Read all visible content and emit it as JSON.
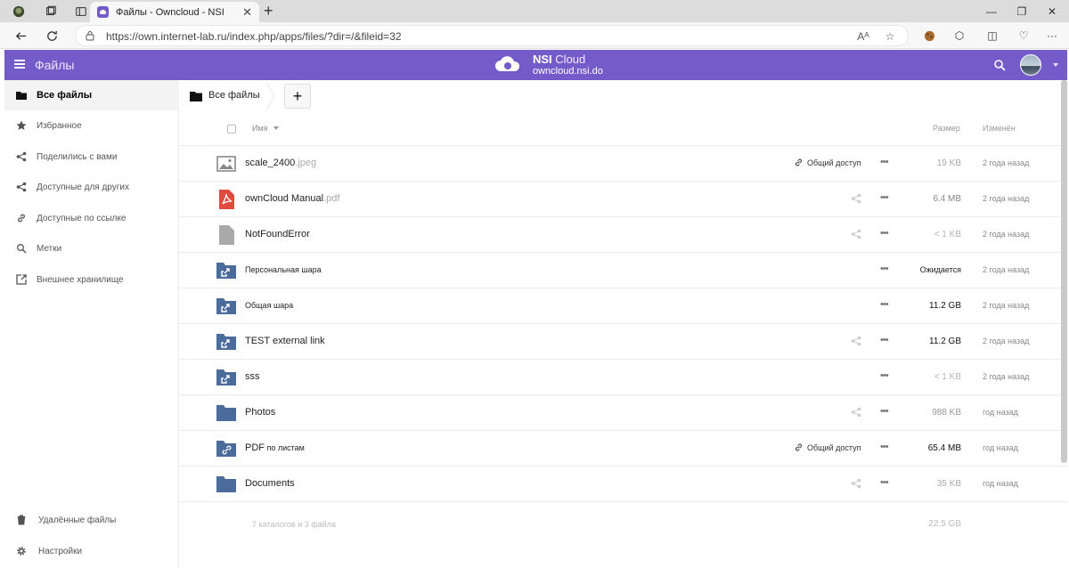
{
  "browser": {
    "tab_title": "Файлы - Owncloud - NSI",
    "url": "https://own.internet-lab.ru/index.php/apps/files/?dir=/&fileid=32"
  },
  "header": {
    "app_title": "Файлы",
    "brand_name": "NSI",
    "brand_suffix": "Cloud",
    "brand_domain": "owncloud.nsi.do",
    "accent_color": "#745bca"
  },
  "sidebar": {
    "items": [
      {
        "label": "Все файлы",
        "icon": "folder-icon",
        "active": true
      },
      {
        "label": "Избранное",
        "icon": "star-icon"
      },
      {
        "label": "Поделились с вами",
        "icon": "share-icon"
      },
      {
        "label": "Доступные для других",
        "icon": "share-icon"
      },
      {
        "label": "Доступные по ссылке",
        "icon": "link-icon"
      },
      {
        "label": "Метки",
        "icon": "search-icon"
      },
      {
        "label": "Внешнее хранилище",
        "icon": "external-icon"
      }
    ],
    "bottom": [
      {
        "label": "Удалённые файлы",
        "icon": "trash-icon"
      },
      {
        "label": "Настройки",
        "icon": "gear-icon"
      }
    ]
  },
  "breadcrumb": {
    "label": "Все файлы"
  },
  "new_button": "+",
  "table": {
    "headers": {
      "name": "Имя",
      "size": "Размер",
      "modified": "Изменён"
    },
    "rows": [
      {
        "name": "scale_2400",
        "ext": ".jpeg",
        "icon": "image-icon",
        "shared_label": "Общий доступ",
        "size": "19 KB",
        "modified": "2 года назад"
      },
      {
        "name": "ownCloud Manual",
        "ext": ".pdf",
        "icon": "pdf-icon",
        "shared_label": "",
        "size": "6.4 MB",
        "modified": "2 года назад"
      },
      {
        "name": "NotFoundError",
        "ext": "",
        "icon": "file-icon",
        "shared_label": "",
        "size": "< 1 KB",
        "modified": "2 года назад"
      },
      {
        "name": "Персональная шара",
        "ext": "",
        "icon": "external-folder-icon",
        "shared_label": "",
        "size": "Ожидается",
        "modified": "2 года назад"
      },
      {
        "name": "Общая шара",
        "ext": "",
        "icon": "external-folder-icon",
        "shared_label": "",
        "size": "11.2 GB",
        "modified": "2 года назад"
      },
      {
        "name": "TEST external link",
        "ext": "",
        "icon": "external-folder-icon",
        "shared_label": "",
        "size": "11.2 GB",
        "modified": "2 года назад"
      },
      {
        "name": "sss",
        "ext": "",
        "icon": "external-folder-icon",
        "shared_label": "",
        "size": "< 1 KB",
        "modified": "2 года назад"
      },
      {
        "name": "Photos",
        "ext": "",
        "icon": "folder-icon",
        "shared_label": "",
        "size": "988 KB",
        "modified": "год назад"
      },
      {
        "name": "PDF",
        "ext": " по листам",
        "icon": "link-folder-icon",
        "shared_label": "Общий доступ",
        "size": "65.4 MB",
        "modified": "год назад"
      },
      {
        "name": "Documents",
        "ext": "",
        "icon": "folder-icon",
        "shared_label": "",
        "size": "35 KB",
        "modified": "год назад"
      }
    ],
    "summary": {
      "text": "7 каталогов и 3 файла",
      "size": "22.5 GB"
    }
  }
}
